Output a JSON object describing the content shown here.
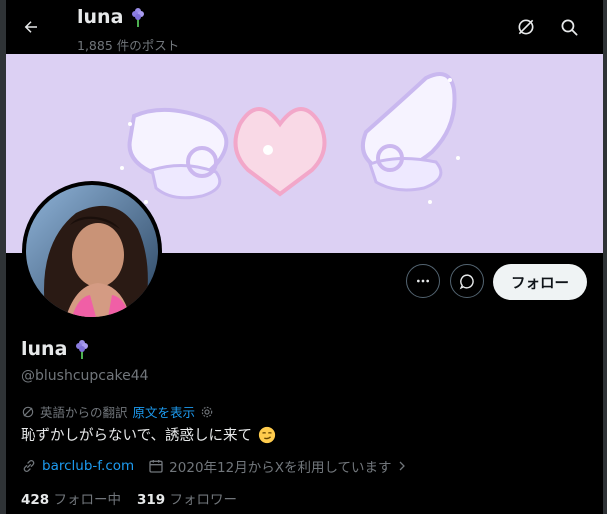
{
  "header": {
    "display_name": "luna",
    "post_count": "1,885 件のポスト"
  },
  "profile": {
    "display_name": "luna",
    "handle": "@blushcupcake44",
    "bio": "恥ずかしがらないで、誘惑しに来て",
    "translation_label": "英語からの翻訳",
    "show_original": "原文を表示",
    "website": "barclub-f.com",
    "joined": "2020年12月からXを利用しています",
    "following_count": "428",
    "following_label": "フォロー中",
    "followers_count": "319",
    "followers_label": "フォロワー",
    "follow_button": "フォロー"
  },
  "colors": {
    "link": "#1d9bf0",
    "banner_bg": "#dcd0f3",
    "muted": "#71767b"
  },
  "icons": [
    "back-arrow-icon",
    "grok-icon",
    "search-icon",
    "more-icon",
    "message-icon",
    "hyacinth-emoji",
    "translate-icon",
    "settings-icon",
    "link-icon",
    "calendar-icon",
    "chevron-right-icon",
    "smirk-emoji"
  ]
}
